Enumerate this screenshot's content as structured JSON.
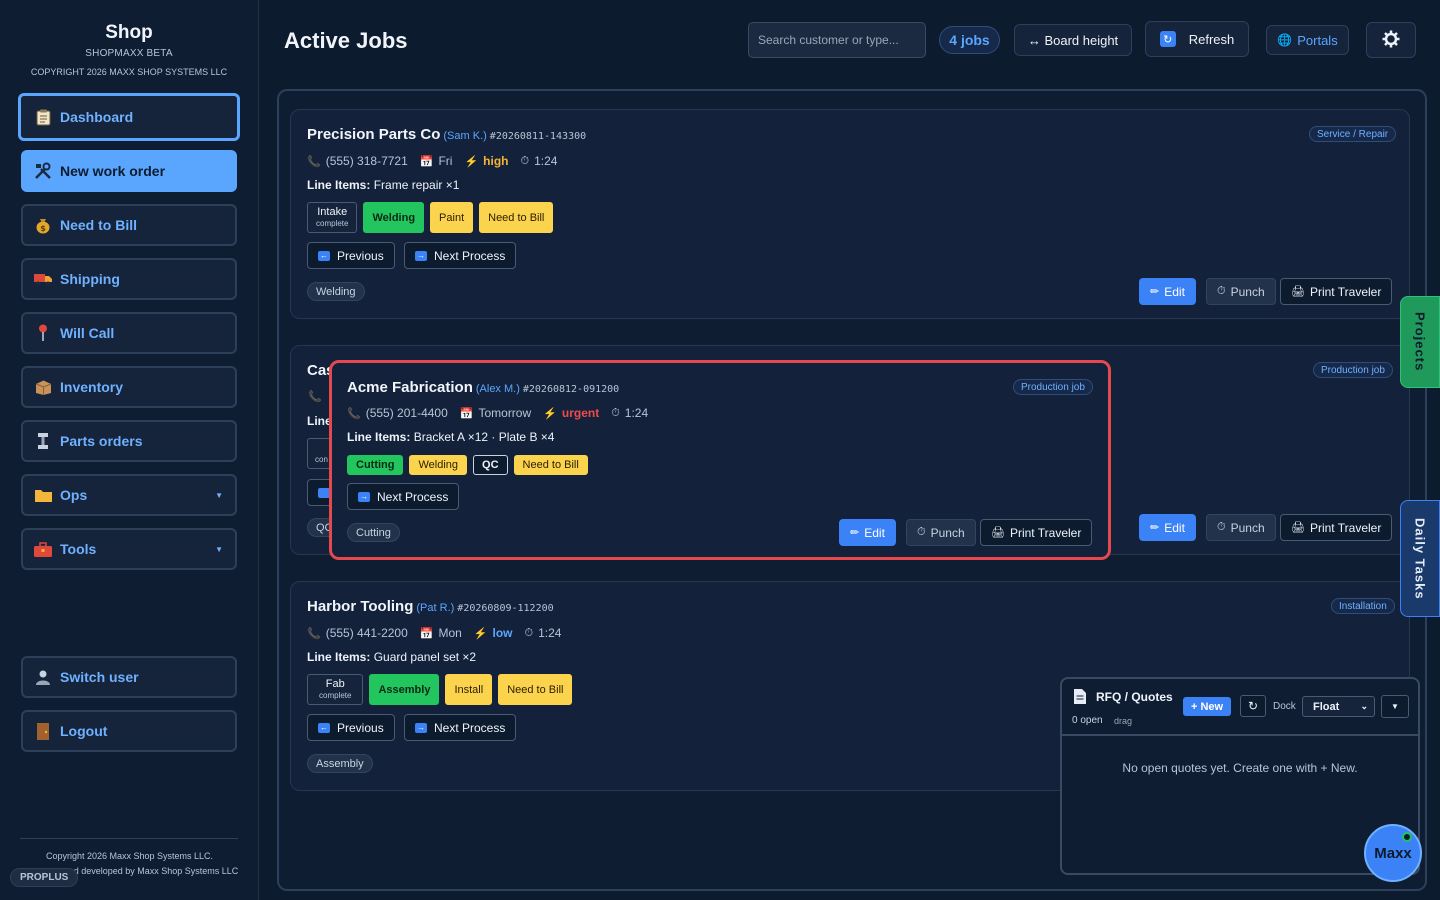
{
  "sidebar": {
    "brand_title": "Shop",
    "brand_sub": "SHOPMAXX BETA",
    "brand_copy": "COPYRIGHT 2026 MAXX SHOP SYSTEMS LLC",
    "items": [
      {
        "label": "Dashboard",
        "icon": "clipboard-icon"
      },
      {
        "label": "New work order",
        "icon": "tools-icon"
      },
      {
        "label": "Need to Bill",
        "icon": "money-bag-icon"
      },
      {
        "label": "Shipping",
        "icon": "truck-icon"
      },
      {
        "label": "Will Call",
        "icon": "pin-icon"
      },
      {
        "label": "Inventory",
        "icon": "box-icon"
      },
      {
        "label": "Parts orders",
        "icon": "parts-icon"
      },
      {
        "label": "Ops",
        "icon": "folder-icon"
      },
      {
        "label": "Tools",
        "icon": "toolbox-icon"
      }
    ],
    "switch_user": "Switch user",
    "logout": "Logout",
    "footer_line1": "Copyright 2026 Maxx Shop Systems LLC.",
    "footer_line2": "nd developed by Maxx Shop Systems LLC",
    "plan_badge": "PROPLUS"
  },
  "header": {
    "title": "Active Jobs",
    "search_placeholder": "Search customer or type...",
    "jobs_count": "4 jobs",
    "board_height": "↔ Board height",
    "refresh": "Refresh",
    "portals": "Portals"
  },
  "jobs": [
    {
      "customer": "Precision Parts Co",
      "rep": "(Sam K.)",
      "id": "#20260811-143300",
      "type": "Service / Repair",
      "phone": "(555) 318-7721",
      "due": "Fri",
      "priority": "high",
      "time": "1:24",
      "line_label": "Line Items:",
      "line_items": "Frame repair ×1",
      "steps": [
        {
          "name": "Intake",
          "sub": "complete",
          "state": "done"
        },
        {
          "name": "Welding",
          "state": "current"
        },
        {
          "name": "Paint",
          "state": "todo"
        },
        {
          "name": "Need to Bill",
          "state": "todo"
        }
      ],
      "previous": "Previous",
      "next": "Next Process",
      "current_tag": "Welding",
      "edit": "Edit",
      "punch": "Punch",
      "print": "Print Traveler"
    },
    {
      "customer": "Cas",
      "type": "Production job",
      "line_label": "Line",
      "done_abbr": "con",
      "current_tag": "QC",
      "edit": "Edit",
      "punch": "Punch",
      "print": "Print Traveler"
    },
    {
      "customer": "Harbor Tooling",
      "rep": "(Pat R.)",
      "id": "#20260809-112200",
      "type": "Installation",
      "phone": "(555) 441-2200",
      "due": "Mon",
      "priority": "low",
      "time": "1:24",
      "line_label": "Line Items:",
      "line_items": "Guard panel set ×2",
      "steps": [
        {
          "name": "Fab",
          "sub": "complete",
          "state": "done"
        },
        {
          "name": "Assembly",
          "state": "current"
        },
        {
          "name": "Install",
          "state": "todo"
        },
        {
          "name": "Need to Bill",
          "state": "todo"
        }
      ],
      "previous": "Previous",
      "next": "Next Process",
      "current_tag": "Assembly"
    }
  ],
  "popup": {
    "customer": "Acme Fabrication",
    "rep": "(Alex M.)",
    "id": "#20260812-091200",
    "type": "Production job",
    "phone": "(555) 201-4400",
    "due": "Tomorrow",
    "priority": "urgent",
    "time": "1:24",
    "line_label": "Line Items:",
    "line_items": "Bracket A ×12 · Plate B ×4",
    "steps": [
      {
        "name": "Cutting",
        "state": "current"
      },
      {
        "name": "Welding",
        "state": "todo"
      },
      {
        "name": "QC",
        "state": "plain"
      },
      {
        "name": "Need to Bill",
        "state": "todo"
      }
    ],
    "next": "Next Process",
    "current_tag": "Cutting",
    "edit": "Edit",
    "punch": "Punch",
    "print": "Print Traveler"
  },
  "side_tabs": {
    "projects": "Projects",
    "daily_tasks": "Daily Tasks"
  },
  "rfq": {
    "title": "RFQ / Quotes",
    "new_btn": "+ New",
    "refresh_glyph": "↻",
    "dock_label": "Dock",
    "dock_value": "Float",
    "open_count": "0 open",
    "drag_hint": "drag",
    "empty": "No open quotes yet. Create one with + New."
  },
  "assistant": {
    "label": "Maxx"
  },
  "colors": {
    "accent": "#5aa6ff",
    "current": "#22c55e",
    "todo": "#fcd34d",
    "urgent": "#ef4b4b",
    "high": "#f5b338",
    "highlight": "#e5484d"
  }
}
